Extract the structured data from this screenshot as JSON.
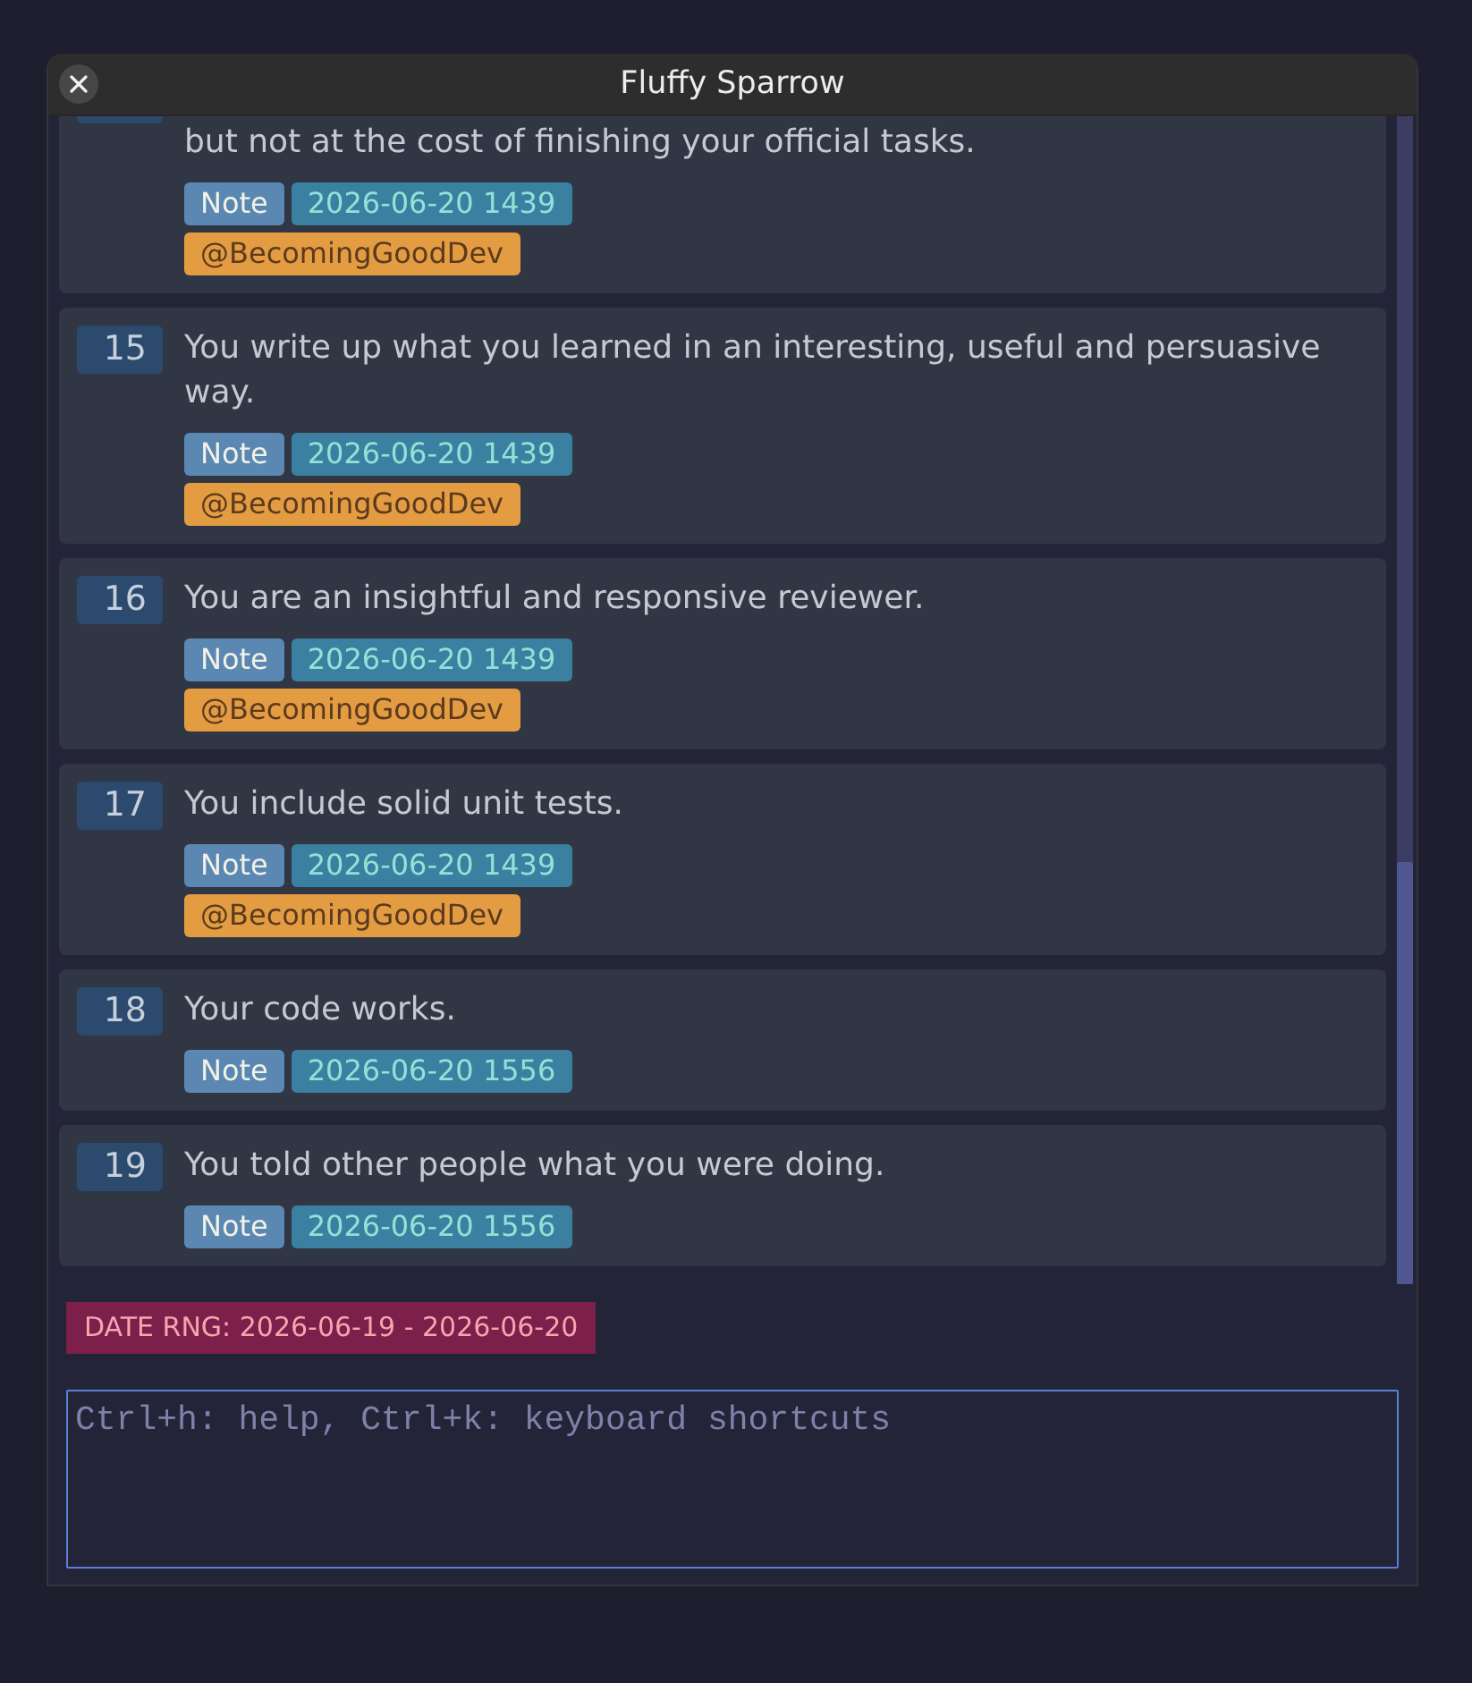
{
  "window": {
    "title": "Fluffy Sparrow"
  },
  "entries": [
    {
      "kind": "clipped",
      "text": "but not at the cost of finishing your official tasks.",
      "tags": [
        {
          "kind": "type",
          "label": "Note"
        },
        {
          "kind": "date",
          "label": "2026-06-20 1439"
        }
      ],
      "mentions": [
        "@BecomingGoodDev"
      ]
    },
    {
      "kind": "full",
      "number": "15",
      "text": "You write up what you learned in an interesting, useful and persuasive way.",
      "tags": [
        {
          "kind": "type",
          "label": "Note"
        },
        {
          "kind": "date",
          "label": "2026-06-20 1439"
        }
      ],
      "mentions": [
        "@BecomingGoodDev"
      ]
    },
    {
      "kind": "full",
      "number": "16",
      "text": "You are an insightful and responsive reviewer.",
      "tags": [
        {
          "kind": "type",
          "label": "Note"
        },
        {
          "kind": "date",
          "label": "2026-06-20 1439"
        }
      ],
      "mentions": [
        "@BecomingGoodDev"
      ]
    },
    {
      "kind": "full",
      "number": "17",
      "text": "You include solid unit tests.",
      "tags": [
        {
          "kind": "type",
          "label": "Note"
        },
        {
          "kind": "date",
          "label": "2026-06-20 1439"
        }
      ],
      "mentions": [
        "@BecomingGoodDev"
      ]
    },
    {
      "kind": "full",
      "number": "18",
      "text": "Your code works.",
      "tags": [
        {
          "kind": "type",
          "label": "Note"
        },
        {
          "kind": "date",
          "label": "2026-06-20 1556"
        }
      ]
    },
    {
      "kind": "full",
      "number": "19",
      "text": "You told other people what you were doing.",
      "tags": [
        {
          "kind": "type",
          "label": "Note"
        },
        {
          "kind": "date",
          "label": "2026-06-20 1556"
        }
      ]
    }
  ],
  "filter": {
    "label": "DATE RNG: 2026-06-19 - 2026-06-20"
  },
  "command_input": {
    "placeholder": "Ctrl+h: help, Ctrl+k: keyboard shortcuts"
  }
}
